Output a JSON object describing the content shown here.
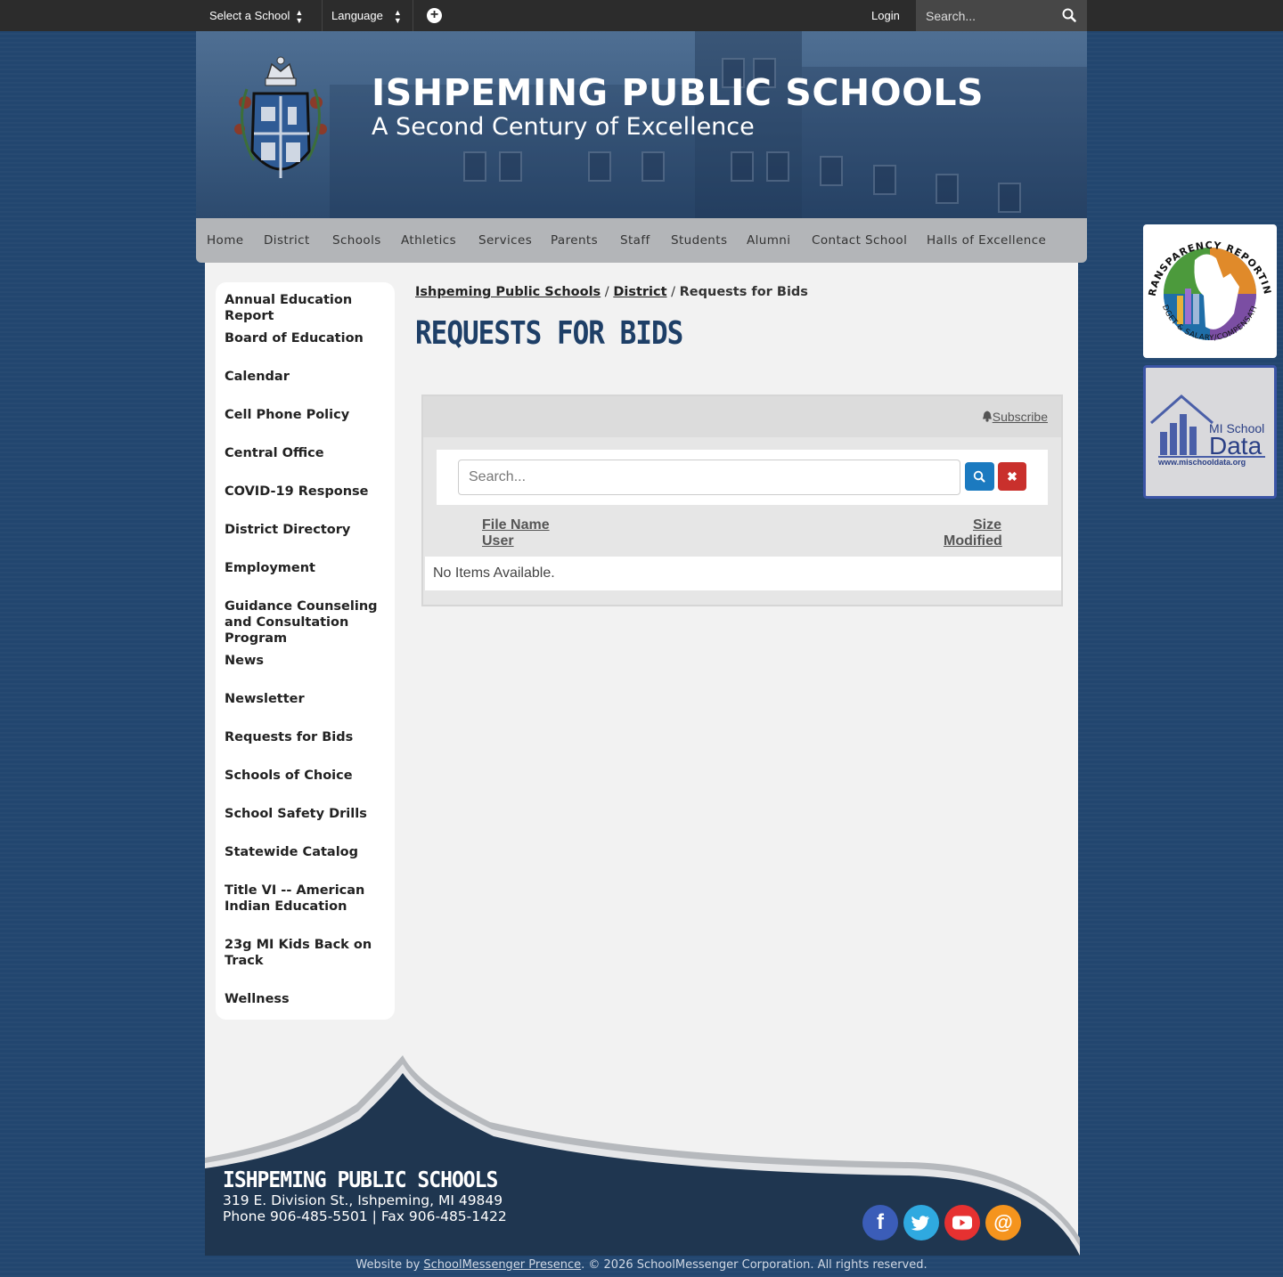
{
  "topbar": {
    "select_school": "Select a School",
    "language": "Language",
    "login": "Login",
    "search_placeholder": "Search..."
  },
  "header": {
    "title": "ISHPEMING PUBLIC SCHOOLS",
    "tagline": "A Second Century of Excellence"
  },
  "nav": {
    "items": [
      "Home",
      "District",
      "Schools",
      "Athletics",
      "Services",
      "Parents",
      "Staff",
      "Students",
      "Alumni",
      "Contact School",
      "Halls of Excellence"
    ]
  },
  "sidebar": {
    "items": [
      "Annual Education Report",
      "Board of Education",
      "Calendar",
      "Cell Phone Policy",
      "Central Office",
      "COVID-19 Response",
      "District Directory",
      "Employment",
      "Guidance Counseling and Consultation Program",
      "News",
      "Newsletter",
      "Requests for Bids",
      "Schools of Choice",
      "School Safety Drills",
      "Statewide Catalog",
      "Title VI -- American Indian Education",
      "23g MI Kids Back on Track",
      "Wellness"
    ]
  },
  "breadcrumb": {
    "home": "Ishpeming Public Schools",
    "district": "District",
    "current": "Requests for Bids"
  },
  "page": {
    "title": "REQUESTS FOR BIDS"
  },
  "file_manager": {
    "subscribe": "Subscribe",
    "search_placeholder": "Search...",
    "col_file_name": "File Name",
    "col_user": "User",
    "col_size": "Size",
    "col_modified": "Modified",
    "empty": "No Items Available."
  },
  "badges": {
    "transparency_top": "TRANSPARENCY REPORTING",
    "transparency_bottom": "BUDGET & SALARY/COMPENSATION",
    "mi_school": "MI School",
    "data": "Data",
    "url": "www.mischooldata.org"
  },
  "footer": {
    "title": "ISHPEMING PUBLIC SCHOOLS",
    "address": "319 E. Division St., Ishpeming, MI 49849",
    "phone": "Phone 906-485-5501 | Fax 906-485-1422",
    "copyright_prefix": "Website by ",
    "copyright_link": "SchoolMessenger Presence",
    "copyright_suffix": ". © 2026 SchoolMessenger Corporation. All rights reserved."
  },
  "colors": {
    "page_bg": "#22466f",
    "title_blue": "#1e3f67",
    "search_btn": "#1b7ac0",
    "clear_btn": "#c9302c",
    "facebook": "#3b5db8",
    "twitter": "#2fa9e0",
    "youtube": "#e63131",
    "email": "#f5941d"
  }
}
